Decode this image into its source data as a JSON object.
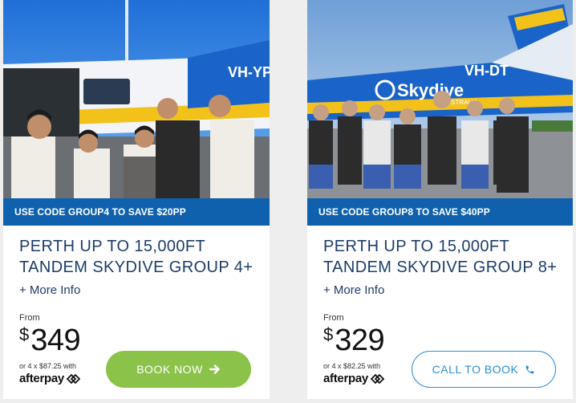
{
  "cards": [
    {
      "photo": {
        "aircraft_registration": "VH-YP",
        "alt": "Group 4 tandem skydivers posing in front of aircraft"
      },
      "promo": "USE CODE GROUP4 TO SAVE $20PP",
      "title": "PERTH UP TO 15,000FT TANDEM SKYDIVE GROUP 4+",
      "more_info": "+ More Info",
      "from_label": "From",
      "currency": "$",
      "price": "349",
      "instalments": "or 4 x $87.25 with",
      "afterpay": "afterpay",
      "button": {
        "label": "BOOK NOW",
        "icon": "arrow-right-icon"
      }
    },
    {
      "photo": {
        "aircraft_registration": "VH-DT",
        "brand_on_plane": "Skydive",
        "brand_sub": "AUSTRALIA",
        "alt": "Group 8 skydivers standing in front of Skydive Australia plane"
      },
      "promo": "USE CODE GROUP8 TO SAVE $40PP",
      "title": "PERTH UP TO 15,000FT TANDEM SKYDIVE GROUP 8+",
      "more_info": "+ More Info",
      "from_label": "From",
      "currency": "$",
      "price": "329",
      "instalments": "or 4 x $82.25 with",
      "afterpay": "afterpay",
      "button": {
        "label": "CALL TO BOOK",
        "icon": "phone-icon"
      }
    }
  ],
  "colors": {
    "promo_bar": "#0f61ae",
    "title_text": "#1c3d6b",
    "book_button": "#8bc34a",
    "call_button_border": "#2b8fd6"
  }
}
